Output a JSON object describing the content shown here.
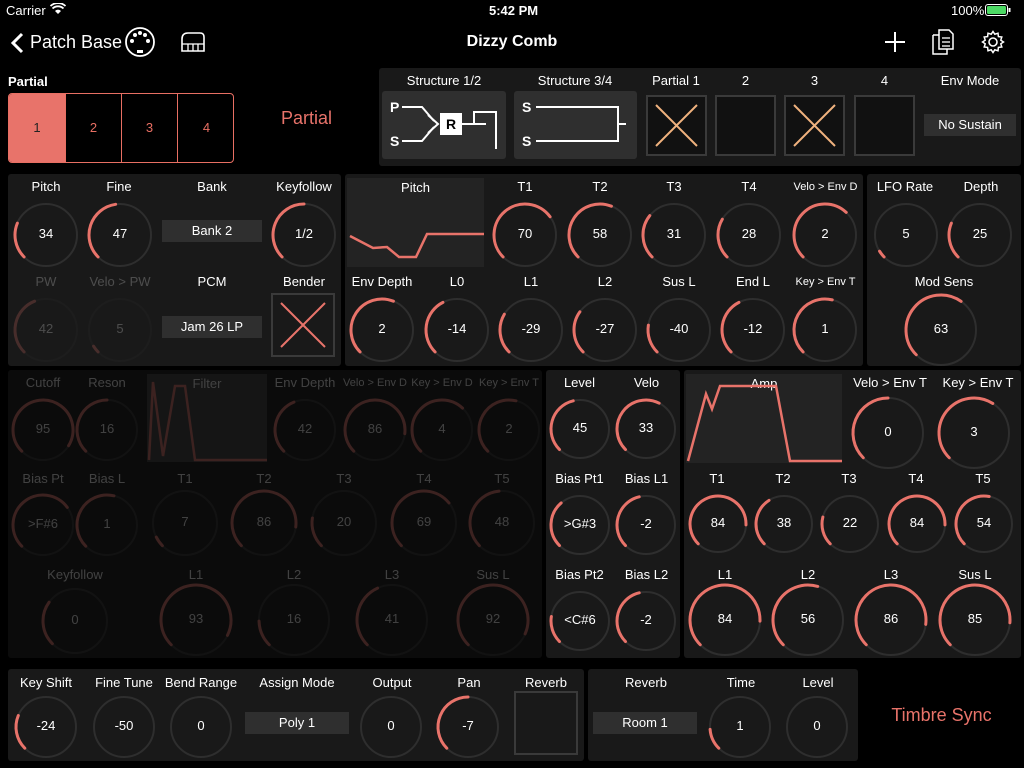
{
  "status": {
    "carrier": "Carrier",
    "time": "5:42 PM",
    "battery": "100%"
  },
  "nav": {
    "back_label": "Patch Base",
    "title": "Dizzy Comb"
  },
  "colors": {
    "accent": "#e8736a",
    "panel": "#191919",
    "button": "#2f2f2f"
  },
  "partial_select": {
    "label": "Partial",
    "items": [
      "1",
      "2",
      "3",
      "4"
    ],
    "selected": "1",
    "side_label": "Partial"
  },
  "structure": {
    "s12_label": "Structure 1/2",
    "s34_label": "Structure 3/4",
    "s12_p": "P",
    "s12_s": "S",
    "s12_r": "R",
    "s34_s1": "S",
    "s34_s2": "S",
    "p1_label": "Partial 1",
    "p2_label": "2",
    "p3_label": "3",
    "p4_label": "4",
    "env_mode_label": "Env Mode",
    "env_mode_value": "No Sustain"
  },
  "wg": {
    "pitch": {
      "label": "Pitch",
      "value": "34"
    },
    "fine": {
      "label": "Fine",
      "value": "47"
    },
    "bank_label": "Bank",
    "bank_value": "Bank 2",
    "keyfollow": {
      "label": "Keyfollow",
      "value": "1/2"
    },
    "pw": {
      "label": "PW",
      "value": "42"
    },
    "velo_pw": {
      "label": "Velo > PW",
      "value": "5"
    },
    "pcm_label": "PCM",
    "pcm_value": "Jam 26 LP",
    "bender_label": "Bender"
  },
  "penv": {
    "pitch_label": "Pitch",
    "t1": {
      "label": "T1",
      "value": "70"
    },
    "t2": {
      "label": "T2",
      "value": "58"
    },
    "t3": {
      "label": "T3",
      "value": "31"
    },
    "t4": {
      "label": "T4",
      "value": "28"
    },
    "velo_env": {
      "label": "Velo > Env D",
      "value": "2"
    },
    "env_depth": {
      "label": "Env Depth",
      "value": "2"
    },
    "l0": {
      "label": "L0",
      "value": "-14"
    },
    "l1": {
      "label": "L1",
      "value": "-29"
    },
    "l2": {
      "label": "L2",
      "value": "-27"
    },
    "susl": {
      "label": "Sus L",
      "value": "-40"
    },
    "endl": {
      "label": "End L",
      "value": "-12"
    },
    "key_env": {
      "label": "Key > Env T",
      "value": "1"
    }
  },
  "lfo": {
    "rate": {
      "label": "LFO Rate",
      "value": "5"
    },
    "depth": {
      "label": "Depth",
      "value": "25"
    },
    "mod_sens": {
      "label": "Mod Sens",
      "value": "63"
    }
  },
  "filter": {
    "cutoff": {
      "label": "Cutoff",
      "value": "95"
    },
    "reson": {
      "label": "Reson",
      "value": "16"
    },
    "filter_label": "Filter",
    "env_depth": {
      "label": "Env Depth",
      "value": "42"
    },
    "velo_env": {
      "label": "Velo > Env D",
      "value": "86"
    },
    "key_env_d": {
      "label": "Key > Env D",
      "value": "4"
    },
    "key_env_t": {
      "label": "Key > Env T",
      "value": "2"
    },
    "bias_pt": {
      "label": "Bias Pt",
      "value": ">F#6"
    },
    "bias_l": {
      "label": "Bias L",
      "value": "1"
    },
    "t1": {
      "label": "T1",
      "value": "7"
    },
    "t2": {
      "label": "T2",
      "value": "86"
    },
    "t3": {
      "label": "T3",
      "value": "20"
    },
    "t4": {
      "label": "T4",
      "value": "69"
    },
    "t5": {
      "label": "T5",
      "value": "48"
    },
    "keyfollow": {
      "label": "Keyfollow",
      "value": "0"
    },
    "l1": {
      "label": "L1",
      "value": "93"
    },
    "l2": {
      "label": "L2",
      "value": "16"
    },
    "l3": {
      "label": "L3",
      "value": "41"
    },
    "susl": {
      "label": "Sus L",
      "value": "92"
    }
  },
  "amp": {
    "level": {
      "label": "Level",
      "value": "45"
    },
    "velo": {
      "label": "Velo",
      "value": "33"
    },
    "bias_pt1": {
      "label": "Bias Pt1",
      "value": ">G#3"
    },
    "bias_l1": {
      "label": "Bias L1",
      "value": "-2"
    },
    "bias_pt2": {
      "label": "Bias Pt2",
      "value": "<C#6"
    },
    "bias_l2": {
      "label": "Bias L2",
      "value": "-2"
    },
    "amp_label": "Amp",
    "velo_env_t": {
      "label": "Velo > Env T",
      "value": "0"
    },
    "key_env_t": {
      "label": "Key > Env T",
      "value": "3"
    },
    "t1": {
      "label": "T1",
      "value": "84"
    },
    "t2": {
      "label": "T2",
      "value": "38"
    },
    "t3": {
      "label": "T3",
      "value": "22"
    },
    "t4": {
      "label": "T4",
      "value": "84"
    },
    "t5": {
      "label": "T5",
      "value": "54"
    },
    "l1": {
      "label": "L1",
      "value": "84"
    },
    "l2": {
      "label": "L2",
      "value": "56"
    },
    "l3": {
      "label": "L3",
      "value": "86"
    },
    "susl": {
      "label": "Sus L",
      "value": "85"
    }
  },
  "common": {
    "key_shift": {
      "label": "Key Shift",
      "value": "-24"
    },
    "fine_tune": {
      "label": "Fine Tune",
      "value": "-50"
    },
    "bend_range": {
      "label": "Bend Range",
      "value": "0"
    },
    "assign_label": "Assign Mode",
    "assign_value": "Poly 1",
    "output": {
      "label": "Output",
      "value": "0"
    },
    "pan": {
      "label": "Pan",
      "value": "-7"
    },
    "reverb_label": "Reverb"
  },
  "reverb": {
    "label": "Reverb",
    "value": "Room 1",
    "time": {
      "label": "Time",
      "value": "1"
    },
    "level": {
      "label": "Level",
      "value": "0"
    }
  },
  "timbre_sync": "Timbre Sync"
}
